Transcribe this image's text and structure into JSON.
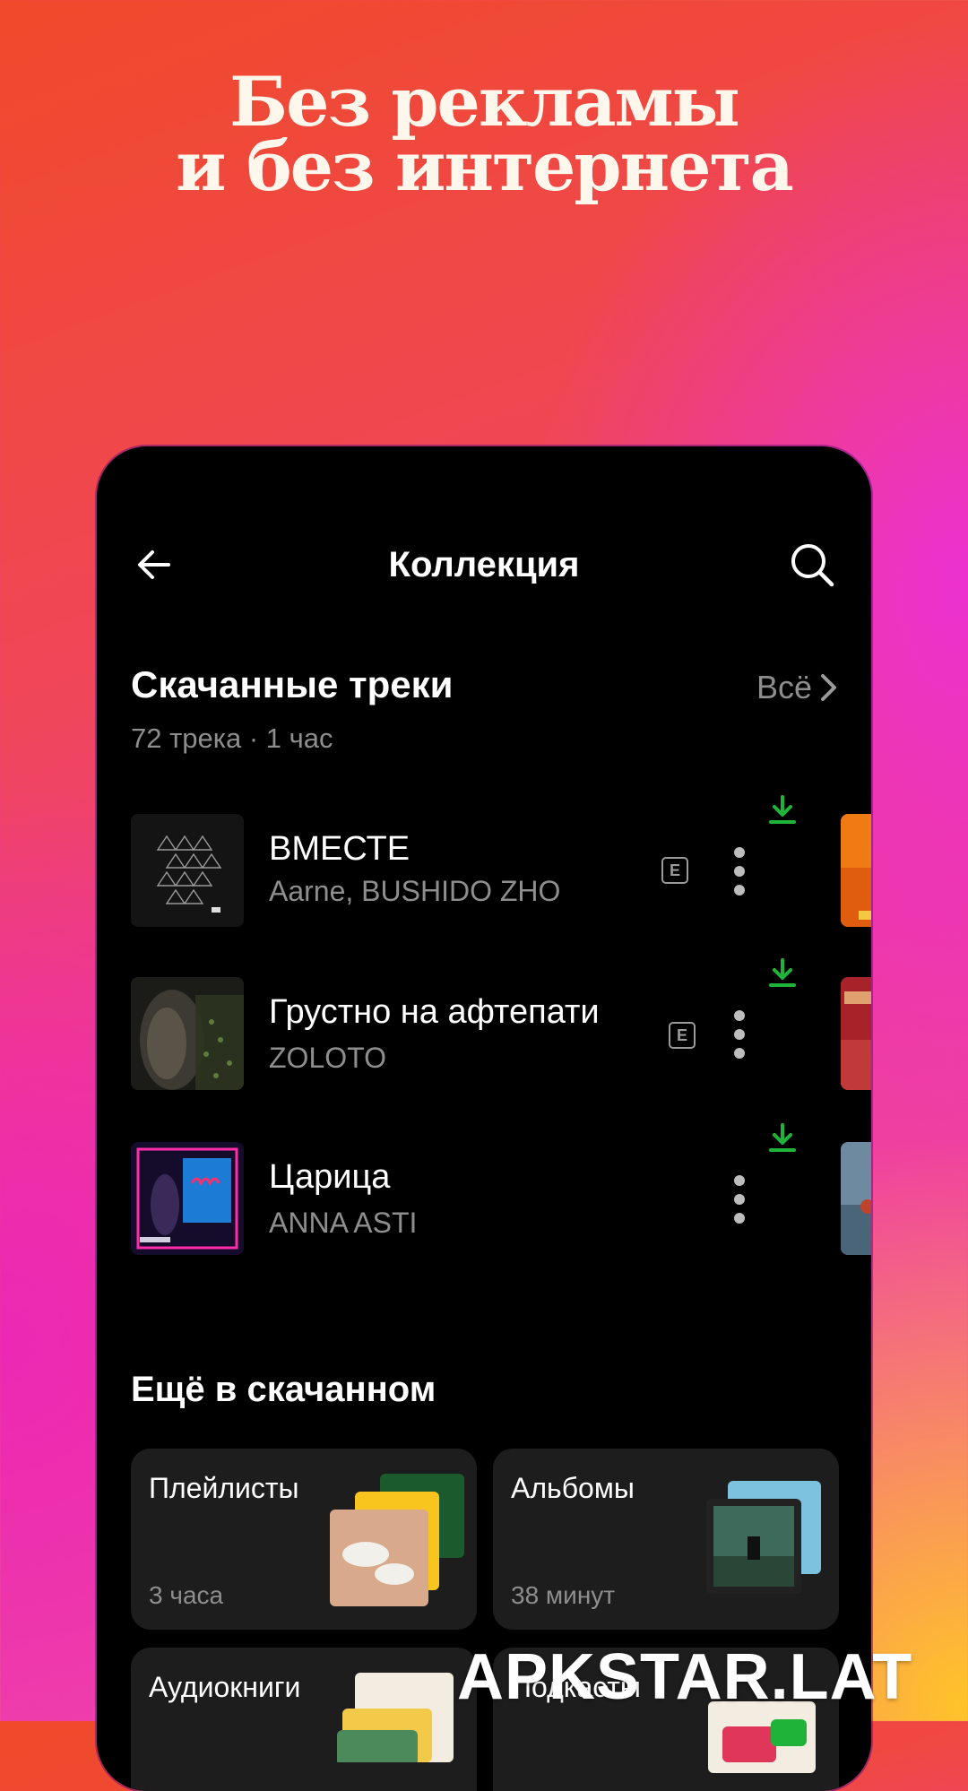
{
  "promo": {
    "line1": "Без рекламы",
    "line2": "и без интернета"
  },
  "header": {
    "title": "Коллекция",
    "back_icon": "arrow-left-icon",
    "search_icon": "search-icon"
  },
  "downloaded": {
    "title": "Скачанные треки",
    "summary": "72 трека · 1 час",
    "all_label": "Всё",
    "tracks": [
      {
        "title": "ВМЕСТЕ",
        "artist": "Aarne, BUSHIDO ZHO",
        "explicit_label": "E"
      },
      {
        "title": "Грустно на афтепати",
        "artist": "ZOLOTO",
        "explicit_label": "E"
      },
      {
        "title": "Царица",
        "artist": "ANNA ASTI"
      }
    ]
  },
  "more": {
    "title": "Ещё в скачанном",
    "cards": [
      {
        "label": "Плейлисты",
        "sub": "3 часа"
      },
      {
        "label": "Альбомы",
        "sub": "38 минут"
      },
      {
        "label": "Аудиокниги"
      },
      {
        "label": "Подкасты"
      }
    ]
  },
  "colors": {
    "download_green": "#1fb33a",
    "background": "#000000",
    "card": "#1d1d1d"
  },
  "watermark": "APKSTAR.LAT"
}
